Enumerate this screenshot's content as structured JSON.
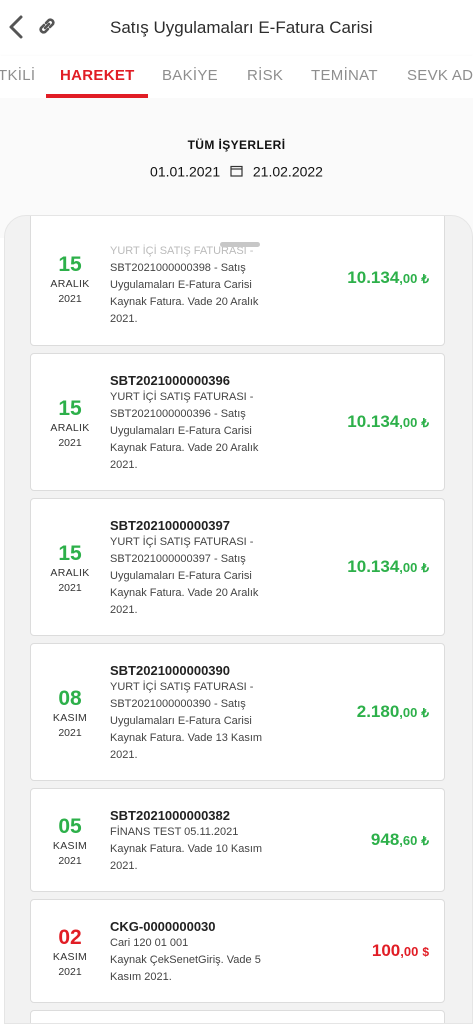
{
  "header": {
    "title": "Satış Uygulamaları E-Fatura Carisi"
  },
  "tabs": [
    "TKİLİ",
    "HAREKET",
    "BAKİYE",
    "RİSK",
    "TEMİNAT",
    "SEVK AD"
  ],
  "filter": {
    "title": "TÜM İŞYERLERİ",
    "start_date": "01.01.2021",
    "end_date": "21.02.2022"
  },
  "transactions": [
    {
      "day": "15",
      "month": "ARALIK",
      "year": "2021",
      "doc_no": "",
      "desc": [
        "YURT İÇİ SATIŞ FATURASI -",
        "SBT2021000000398 - Satış",
        "Uygulamaları E-Fatura Carisi",
        "Kaynak Fatura. Vade 20 Aralık",
        "2021."
      ],
      "amount_main": "10.134",
      "amount_dec": ",00",
      "currency": "₺"
    },
    {
      "day": "15",
      "month": "ARALIK",
      "year": "2021",
      "doc_no": "SBT2021000000396",
      "desc": [
        "YURT İÇİ SATIŞ FATURASI -",
        "SBT2021000000396 - Satış",
        "Uygulamaları E-Fatura Carisi",
        "Kaynak Fatura. Vade 20 Aralık",
        "2021."
      ],
      "amount_main": "10.134",
      "amount_dec": ",00",
      "currency": "₺"
    },
    {
      "day": "15",
      "month": "ARALIK",
      "year": "2021",
      "doc_no": "SBT2021000000397",
      "desc": [
        "YURT İÇİ SATIŞ FATURASI -",
        "SBT2021000000397 - Satış",
        "Uygulamaları E-Fatura Carisi",
        "Kaynak Fatura. Vade 20 Aralık",
        "2021."
      ],
      "amount_main": "10.134",
      "amount_dec": ",00",
      "currency": "₺"
    },
    {
      "day": "08",
      "month": "KASIM",
      "year": "2021",
      "doc_no": "SBT2021000000390",
      "desc": [
        "YURT İÇİ SATIŞ FATURASI -",
        "SBT2021000000390 - Satış",
        "Uygulamaları E-Fatura Carisi",
        "Kaynak Fatura. Vade 13 Kasım",
        "2021."
      ],
      "amount_main": "2.180",
      "amount_dec": ",00",
      "currency": "₺"
    },
    {
      "day": "05",
      "month": "KASIM",
      "year": "2021",
      "doc_no": "SBT2021000000382",
      "desc": [
        "FİNANS TEST 05.11.2021",
        "Kaynak Fatura. Vade 10 Kasım",
        "2021."
      ],
      "amount_main": "948",
      "amount_dec": ",60",
      "currency": "₺"
    },
    {
      "day": "02",
      "month": "KASIM",
      "year": "2021",
      "doc_no": "CKG-0000000030",
      "desc": [
        "Cari 120 01 001",
        "Kaynak ÇekSenetGiriş. Vade 5",
        "Kasım 2021."
      ],
      "amount_main": "100",
      "amount_dec": ",00",
      "currency": "$"
    }
  ],
  "colors": {
    "accent": "#e11d25",
    "positive": "#2db04a",
    "negative": "#e11d25"
  }
}
